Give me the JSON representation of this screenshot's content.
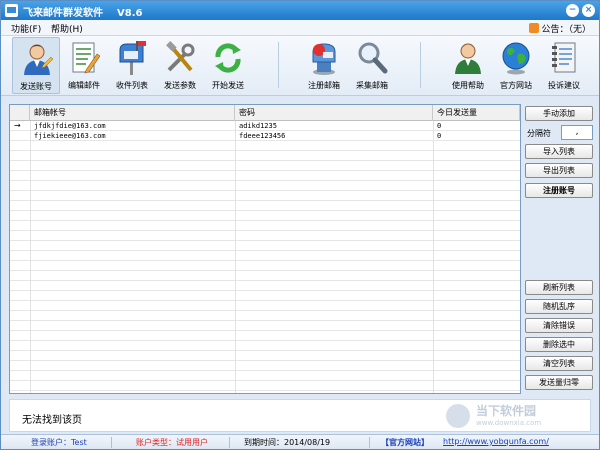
{
  "window": {
    "title": "飞来邮件群发软件",
    "version": "V8.6",
    "controls": {
      "minimize": "−",
      "close": "×"
    }
  },
  "menu": {
    "items": [
      "功能(F)",
      "帮助(H)"
    ],
    "announcement": "公告：（无）"
  },
  "toolbar": {
    "left": [
      {
        "label": "发送账号",
        "icon": "user-icon"
      },
      {
        "label": "编辑邮件",
        "icon": "edit-document-icon"
      },
      {
        "label": "收件列表",
        "icon": "mailbox-icon"
      },
      {
        "label": "发送参数",
        "icon": "tools-icon"
      },
      {
        "label": "开始发送",
        "icon": "refresh-icon"
      }
    ],
    "middle": [
      {
        "label": "注册邮箱",
        "icon": "mailbox-register-icon"
      },
      {
        "label": "采集邮箱",
        "icon": "magnifier-icon"
      }
    ],
    "right": [
      {
        "label": "使用帮助",
        "icon": "help-user-icon"
      },
      {
        "label": "官方网站",
        "icon": "globe-icon"
      },
      {
        "label": "投诉建议",
        "icon": "notebook-icon"
      }
    ]
  },
  "grid": {
    "columns": [
      "邮箱帐号",
      "密码",
      "今日发送量"
    ],
    "marker": "→",
    "rows": [
      [
        "jfdkjfdie@163.com",
        "adikd1235",
        "0"
      ],
      [
        "fjiekieee@163.com",
        "fdeee123456",
        "0"
      ]
    ]
  },
  "side_buttons": {
    "manual_add": "手动添加",
    "separator_label": "分隔符",
    "separator_value": ",",
    "import_list": "导入列表",
    "export_list": "导出列表",
    "register_account": "注册账号",
    "refresh_list": "刷新列表",
    "shuffle": "随机乱序",
    "clear_errors": "清除错误",
    "delete_selected": "删除选中",
    "clear_list": "清空列表",
    "reset_count": "发送量归零"
  },
  "message": "无法找到该页",
  "watermark": {
    "text": "当下软件园",
    "url": "www.downxia.com"
  },
  "status": {
    "login": "登录账户：Test",
    "account_type": "账户类型：试用用户",
    "expiry": "到期时间：2014/08/19",
    "site_label": "【官方网站】",
    "site_url": "http://www.yobqunfa.com/"
  },
  "colors": {
    "titlebar": "#1f78c8",
    "account_type": "#e02020",
    "site_label": "#1a3fb8",
    "link": "#1a3fb8"
  }
}
